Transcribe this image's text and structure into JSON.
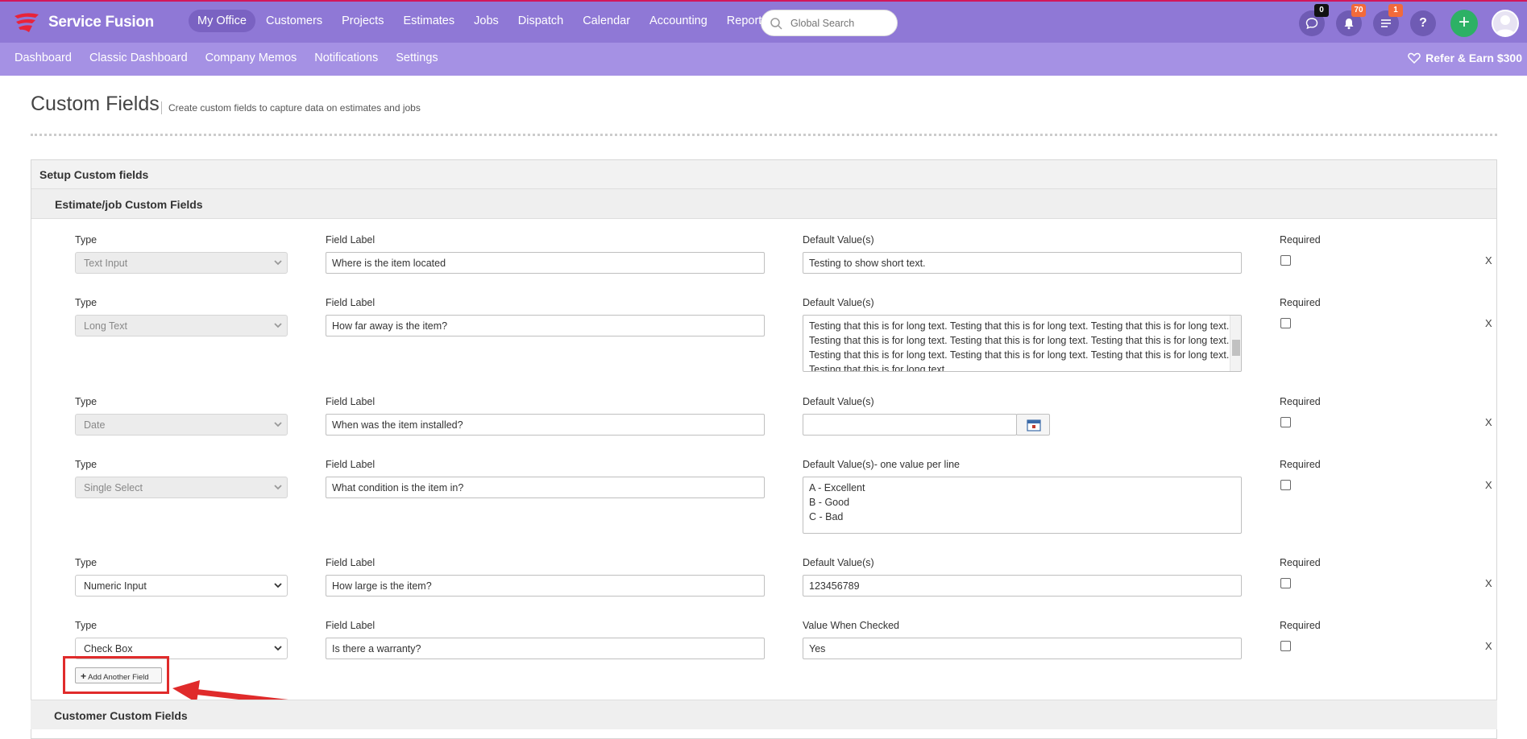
{
  "app": {
    "name": "Service Fusion",
    "brand_color": "#8f78d6",
    "subnav_color": "#a591e4"
  },
  "nav": {
    "items": [
      {
        "label": "My Office",
        "active": true
      },
      {
        "label": "Customers"
      },
      {
        "label": "Projects"
      },
      {
        "label": "Estimates"
      },
      {
        "label": "Jobs"
      },
      {
        "label": "Dispatch"
      },
      {
        "label": "Calendar"
      },
      {
        "label": "Accounting"
      },
      {
        "label": "Reports"
      }
    ],
    "search_placeholder": "Global Search",
    "chat_count": "0",
    "notification_count": "70",
    "tasks_count": "1",
    "help_icon": "?",
    "add_icon": "+"
  },
  "subnav": {
    "items": [
      "Dashboard",
      "Classic Dashboard",
      "Company Memos",
      "Notifications",
      "Settings"
    ],
    "refer": "Refer & Earn $300"
  },
  "page": {
    "title": "Custom Fields",
    "subtitle": "Create custom fields to capture data on estimates and jobs"
  },
  "panel": {
    "title": "Setup Custom fields",
    "section_title": "Estimate/job Custom Fields",
    "type_label": "Type",
    "field_label": "Field Label",
    "required_label": "Required",
    "remove_label": "X",
    "rows": [
      {
        "type": "Text Input",
        "label": "Where is the item located",
        "default_heading": "Default Value(s)",
        "default": "Testing to show short text."
      },
      {
        "type": "Long Text",
        "label": "How far away is the item?",
        "default_heading": "Default Value(s)",
        "default_lines": [
          "Testing that this is for long text. Testing that this is for long text. Testing that this is for long text.",
          "Testing that this is for long text. Testing that this is for long text. Testing that this is for long text.",
          "Testing that this is for long text. Testing that this is for long text. Testing that this is for long text.",
          "Testing that this is for long text."
        ]
      },
      {
        "type": "Date",
        "label": "When was the item installed?",
        "default_heading": "Default Value(s)",
        "default": ""
      },
      {
        "type": "Single Select",
        "label": "What condition is the item in?",
        "default_heading": "Default Value(s)- one value per line",
        "default_lines": [
          "A - Excellent",
          "B - Good",
          "C - Bad"
        ]
      },
      {
        "type": "Numeric Input",
        "label": "How large is the item?",
        "default_heading": "Default Value(s)",
        "default": "123456789"
      },
      {
        "type": "Check Box",
        "label": "Is there a warranty?",
        "default_heading": "Value When Checked",
        "default": "Yes"
      }
    ],
    "add_button": "Add Another Field",
    "next_section_title": "Customer Custom Fields"
  }
}
